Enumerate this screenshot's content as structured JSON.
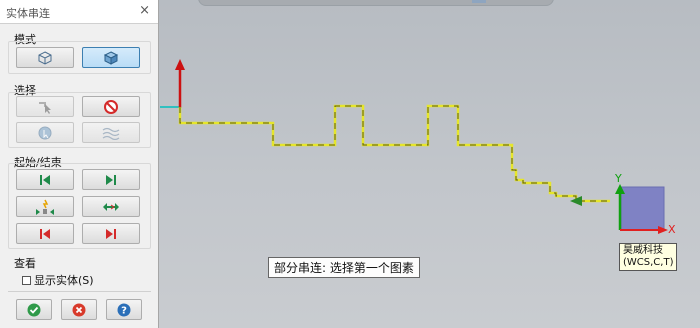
{
  "dialog": {
    "title": "实体串连",
    "close_glyph": "×"
  },
  "groups": {
    "mode": "模式",
    "select": "选择",
    "start_end": "起始/结束",
    "view": "查看"
  },
  "view_option": {
    "label": "显示实体(S)",
    "checked": false
  },
  "status_prompt": "部分串连: 选择第一个图素",
  "wcs_label": {
    "line1": "昊威科技",
    "line2": "(WCS,C,T)"
  },
  "axes": {
    "x_label": "X",
    "y_label": "Y"
  },
  "colors": {
    "x_axis": "#e02020",
    "y_axis": "#10a010",
    "origin_axis_y": "#cc1111",
    "origin_axis_x": "#30c0c0",
    "chain": "#e6e62a",
    "plane": "#7f82c4"
  }
}
